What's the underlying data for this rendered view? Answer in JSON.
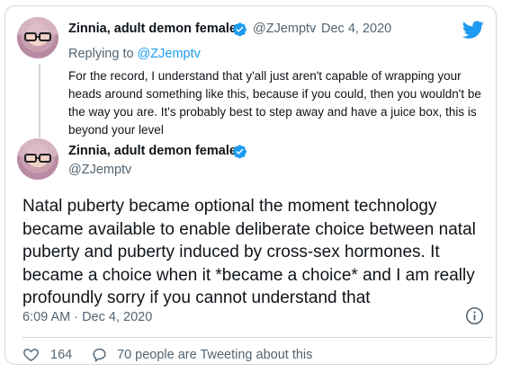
{
  "reply_tweet": {
    "display_name": "Zinnia, adult demon female",
    "handle": "@ZJemptv",
    "separator": "·",
    "date": "Dec 4, 2020",
    "replying_to_label": "Replying to",
    "replying_to_handle": "@ZJemptv",
    "text": "For the record, I understand that y'all just aren't capable of wrapping your heads around something like this, because if you could, then you wouldn't be the way you are. It's probably best to step away and have a juice box, this is beyond your level"
  },
  "main_tweet": {
    "display_name": "Zinnia, adult demon female",
    "handle": "@ZJemptv",
    "text": "Natal puberty became optional the moment technology became available to enable deliberate choice between natal puberty and puberty induced by cross-sex hormones. It became a choice when it *became a choice* and I am really profoundly sorry if you cannot understand that",
    "timestamp": "6:09 AM · Dec 4, 2020"
  },
  "actions": {
    "like_count": "164",
    "tweeting_label": "70 people are Tweeting about this"
  },
  "icons": {
    "brand": "twitter-bird-icon",
    "verified": "verified-badge-icon",
    "info": "info-icon",
    "like": "heart-icon",
    "reply": "speech-bubble-icon"
  },
  "colors": {
    "brand_blue": "#1d9bf0",
    "secondary_text": "#536471",
    "border": "#cfd9de"
  }
}
